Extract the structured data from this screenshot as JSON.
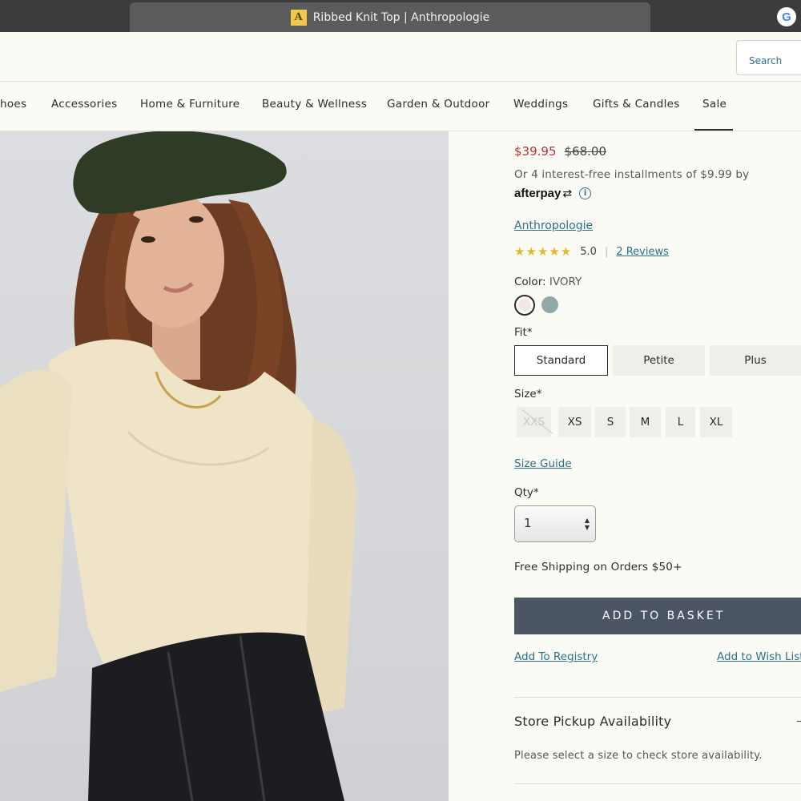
{
  "browser": {
    "tab_title": "Ribbed Knit Top | Anthropologie",
    "favicon_letter": "A",
    "profile_icon": "G"
  },
  "header": {
    "search_label": "Search"
  },
  "nav": {
    "items": [
      "hoes",
      "Accessories",
      "Home & Furniture",
      "Beauty & Wellness",
      "Garden & Outdoor",
      "Weddings",
      "Gifts & Candles",
      "Sale"
    ],
    "active": "Sale"
  },
  "product": {
    "price_sale": "$39.95",
    "price_original": "$68.00",
    "installments_text": "Or 4 interest-free installments of $9.99 by",
    "afterpay_logo": "afterpay",
    "brand": "Anthropologie",
    "stars": "★★★★★",
    "rating": "5.0",
    "rating_separator": "|",
    "reviews_link": "2 Reviews",
    "color_label": "Color:",
    "color_value": "IVORY",
    "colors": [
      {
        "name": "ivory",
        "hex": "#f3e8e6"
      },
      {
        "name": "sage",
        "hex": "#8fa9a8"
      }
    ],
    "fit_label": "Fit*",
    "fits": [
      "Standard",
      "Petite",
      "Plus"
    ],
    "fit_selected": "Standard",
    "size_label": "Size*",
    "sizes": [
      "XXS",
      "XS",
      "S",
      "M",
      "L",
      "XL"
    ],
    "size_unavailable": "XXS",
    "size_guide": "Size Guide",
    "qty_label": "Qty*",
    "qty_value": "1",
    "free_shipping": "Free Shipping on Orders $50+",
    "add_to_basket": "ADD TO BASKET",
    "add_to_registry": "Add To Registry",
    "add_to_wishlist": "Add to Wish List",
    "pickup_title": "Store Pickup Availability",
    "pickup_toggle": "–",
    "pickup_note": "Please select a size to check store availability."
  },
  "colors": {
    "link": "#2f6f86",
    "sale_price": "#b3343a",
    "basket_button": "#4b5563",
    "star": "#e4b730"
  }
}
